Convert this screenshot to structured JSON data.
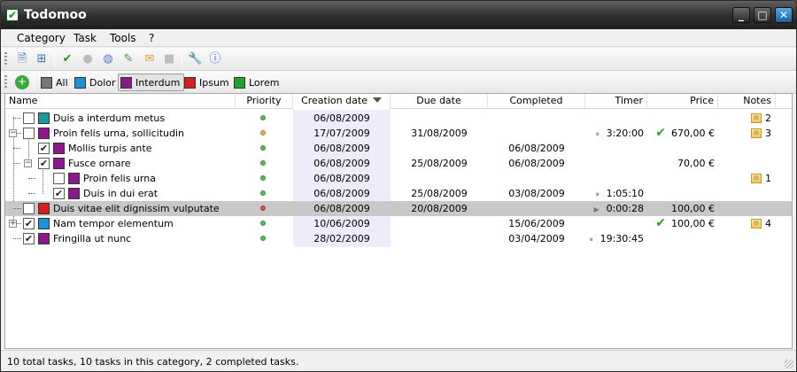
{
  "window": {
    "title": "Todomoo",
    "controls": {
      "min": "_",
      "max": "□",
      "close": "✕"
    }
  },
  "menu": [
    "Category",
    "Task",
    "Tools",
    "?"
  ],
  "toolbar": {
    "icons": [
      "add-task-icon",
      "add-subtask-icon",
      "complete-task-icon",
      "play-timer-icon",
      "pause-timer-icon",
      "edit-task-icon",
      "new-note-icon",
      "stop-icon",
      "tools-icon",
      "info-icon"
    ]
  },
  "categories": {
    "items": [
      {
        "label": "All",
        "color": "#777777"
      },
      {
        "label": "Dolor",
        "color": "#1f8fd6"
      },
      {
        "label": "Interdum",
        "color": "#8a1a8a",
        "active": true
      },
      {
        "label": "Ipsum",
        "color": "#d42020"
      },
      {
        "label": "Lorem",
        "color": "#1fa32a"
      }
    ]
  },
  "columns": [
    "Name",
    "Priority",
    "Creation date",
    "Due date",
    "Completed",
    "Timer",
    "Price",
    "Notes"
  ],
  "rows": [
    {
      "name": "Duis a interdum metus",
      "cat_color": "#1a9a9a",
      "checked": false,
      "priority_color": "#5bb85b",
      "created": "06/08/2009",
      "due": "",
      "completed": "",
      "timer": "",
      "timer_icon": "",
      "price": "",
      "price_check": false,
      "notes": "2"
    },
    {
      "name": "Proin felis urna, sollicitudin",
      "cat_color": "#8a1a8a",
      "checked": false,
      "priority_color": "#e3b04b",
      "created": "17/07/2009",
      "due": "31/08/2009",
      "completed": "",
      "timer": "3:20:00",
      "timer_icon": "⏸",
      "price": "670,00 €",
      "price_check": true,
      "notes": "3"
    },
    {
      "name": "Mollis turpis ante",
      "cat_color": "#8a1a8a",
      "checked": true,
      "priority_color": "#5bb85b",
      "created": "06/08/2009",
      "due": "",
      "completed": "06/08/2009",
      "timer": "",
      "timer_icon": "",
      "price": "",
      "price_check": false,
      "notes": ""
    },
    {
      "name": "Fusce ornare",
      "cat_color": "#8a1a8a",
      "checked": true,
      "priority_color": "#5bb85b",
      "created": "06/08/2009",
      "due": "25/08/2009",
      "completed": "06/08/2009",
      "timer": "",
      "timer_icon": "",
      "price": "70,00 €",
      "price_check": false,
      "notes": ""
    },
    {
      "name": "Proin felis urna",
      "cat_color": "#8a1a8a",
      "checked": false,
      "priority_color": "#5bb85b",
      "created": "06/08/2009",
      "due": "",
      "completed": "",
      "timer": "",
      "timer_icon": "",
      "price": "",
      "price_check": false,
      "notes": "1"
    },
    {
      "name": "Duis in dui erat",
      "cat_color": "#8a1a8a",
      "checked": true,
      "priority_color": "#5bb85b",
      "created": "06/08/2009",
      "due": "25/08/2009",
      "completed": "03/08/2009",
      "timer": "1:05:10",
      "timer_icon": "⏸",
      "price": "",
      "price_check": false,
      "notes": ""
    },
    {
      "name": "Duis vitae elit dignissim vulputate",
      "cat_color": "#d42020",
      "checked": false,
      "priority_color": "#e05050",
      "created": "06/08/2009",
      "due": "20/08/2009",
      "completed": "",
      "timer": "0:00:28",
      "timer_icon": "▶",
      "price": "100,00 €",
      "price_check": false,
      "notes": "",
      "selected": true
    },
    {
      "name": "Nam tempor elementum",
      "cat_color": "#1f8fd6",
      "checked": true,
      "priority_color": "#5bb85b",
      "created": "10/06/2009",
      "due": "",
      "completed": "15/06/2009",
      "timer": "",
      "timer_icon": "",
      "price": "100,00 €",
      "price_check": true,
      "notes": "4"
    },
    {
      "name": "Fringilla ut nunc",
      "cat_color": "#8a1a8a",
      "checked": true,
      "priority_color": "#5bb85b",
      "created": "28/02/2009",
      "due": "",
      "completed": "03/04/2009",
      "timer": "19:30:45",
      "timer_icon": "⏸",
      "price": "",
      "price_check": false,
      "notes": ""
    }
  ],
  "status": "10 total tasks, 10 tasks in this category, 2 completed tasks."
}
